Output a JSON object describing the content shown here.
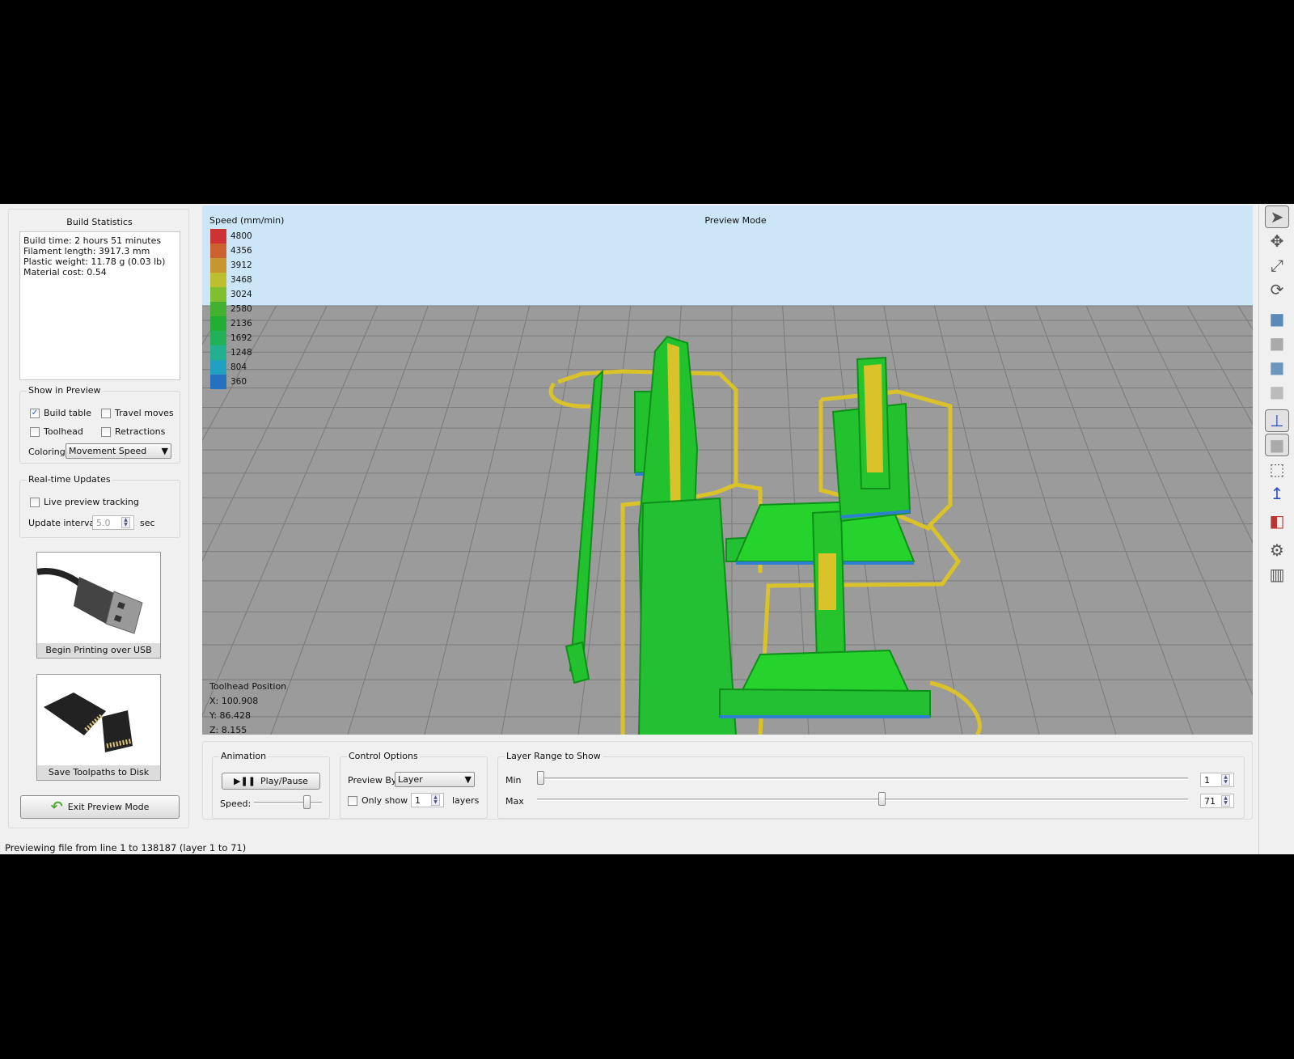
{
  "left_panel": {
    "build_statistics": {
      "title": "Build Statistics",
      "lines": [
        "Build time: 2 hours 51 minutes",
        "Filament length: 3917.3 mm",
        "Plastic weight: 11.78 g (0.03 lb)",
        "Material cost: 0.54"
      ]
    },
    "show_in_preview": {
      "title": "Show in Preview",
      "build_table": {
        "label": "Build table",
        "checked": true
      },
      "travel_moves": {
        "label": "Travel moves",
        "checked": false
      },
      "toolhead": {
        "label": "Toolhead",
        "checked": false
      },
      "retractions": {
        "label": "Retractions",
        "checked": false
      },
      "coloring_label": "Coloring",
      "coloring_value": "Movement Speed"
    },
    "realtime_updates": {
      "title": "Real-time Updates",
      "live_tracking": {
        "label": "Live preview tracking",
        "checked": false
      },
      "interval_label": "Update interval",
      "interval_value": "5.0",
      "interval_unit": "sec"
    },
    "usb_button": "Begin Printing over USB",
    "sd_button": "Save Toolpaths to Disk",
    "exit_button": "Exit Preview Mode"
  },
  "viewport": {
    "mode_label": "Preview Mode",
    "legend_title": "Speed (mm/min)",
    "legend": [
      {
        "value": "4800",
        "color": "#cf3232"
      },
      {
        "value": "4356",
        "color": "#cc6130"
      },
      {
        "value": "3912",
        "color": "#c8962e"
      },
      {
        "value": "3468",
        "color": "#bdbf2e"
      },
      {
        "value": "3024",
        "color": "#80c030"
      },
      {
        "value": "2580",
        "color": "#44b030"
      },
      {
        "value": "2136",
        "color": "#22ad34"
      },
      {
        "value": "1692",
        "color": "#22b058"
      },
      {
        "value": "1248",
        "color": "#22b08e"
      },
      {
        "value": "804",
        "color": "#22a0c0"
      },
      {
        "value": "360",
        "color": "#2670c0"
      }
    ],
    "toolhead": {
      "title": "Toolhead Position",
      "x": "X: 100.908",
      "y": "Y: 86.428",
      "z": "Z: 8.155"
    }
  },
  "bottom": {
    "animation": {
      "title": "Animation",
      "play_pause": "Play/Pause",
      "speed_label": "Speed:",
      "speed_fraction": 0.8
    },
    "control_options": {
      "title": "Control Options",
      "preview_by_label": "Preview By",
      "preview_by_value": "Layer",
      "only_show_label": "Only show",
      "only_show_checked": false,
      "only_show_value": "1",
      "layers_label": "layers"
    },
    "layer_range": {
      "title": "Layer Range to Show",
      "min_label": "Min",
      "max_label": "Max",
      "min_value": "1",
      "max_value": "71",
      "min_fraction": 0.0,
      "max_fraction": 0.53
    }
  },
  "toolbar": [
    "select-icon",
    "move-icon",
    "scale-icon",
    "rotate-icon",
    "view-top-icon",
    "view-front-icon",
    "view-side-icon",
    "view-iso-icon",
    "axes-icon",
    "solid-view-icon",
    "wireframe-icon",
    "normals-icon",
    "cross-section-icon",
    "settings-icon",
    "supports-icon"
  ],
  "status_bar": "Previewing file from line 1 to 138187 (layer 1 to 71)"
}
